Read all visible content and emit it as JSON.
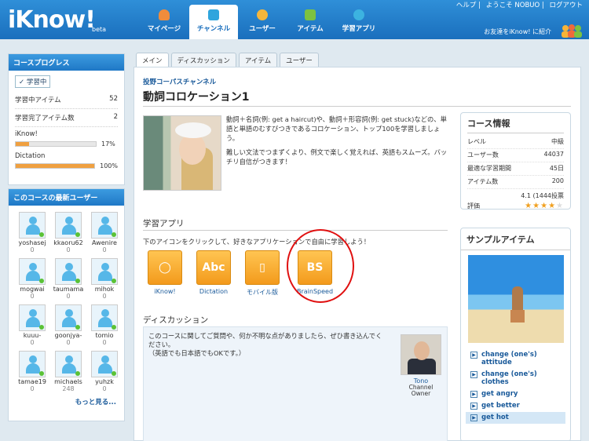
{
  "header": {
    "logo": "iKnow!",
    "beta": "beta",
    "top_links": [
      "ヘルプ",
      "ようこそ NOBUO",
      "ログアウト"
    ],
    "nav": [
      {
        "label": "マイページ",
        "icon": "person-icon",
        "color": "#f08c3c"
      },
      {
        "label": "チャンネル",
        "icon": "tv-icon",
        "color": "#2fa5dd"
      },
      {
        "label": "ユーザー",
        "icon": "users-icon",
        "color": "#f5b63c"
      },
      {
        "label": "アイテム",
        "icon": "list-icon",
        "color": "#7cc242"
      },
      {
        "label": "学習アプリ",
        "icon": "bubble-icon",
        "color": "#3cb3e0"
      }
    ],
    "active_nav": 1,
    "invite": "お友達をiKnow! に紹介"
  },
  "progress_panel": {
    "title": "コースプログレス",
    "status": "✓ 学習中",
    "rows": [
      {
        "label": "学習中アイテム",
        "value": "52"
      },
      {
        "label": "学習完了アイテム数",
        "value": "2"
      }
    ],
    "bars": [
      {
        "label": "iKnow!",
        "percent": 17,
        "display": "17%"
      },
      {
        "label": "Dictation",
        "percent": 100,
        "display": "100%"
      }
    ]
  },
  "users_panel": {
    "title": "このコースの最新ユーザー",
    "users": [
      {
        "name": "yoshasej",
        "count": "0"
      },
      {
        "name": "kkaoru62",
        "count": "0"
      },
      {
        "name": "Awenire",
        "count": "0"
      },
      {
        "name": "mogwai",
        "count": "0"
      },
      {
        "name": "taumama",
        "count": "0"
      },
      {
        "name": "mihok",
        "count": "0"
      },
      {
        "name": "kuuu-",
        "count": "0"
      },
      {
        "name": "goonjya-",
        "count": "0"
      },
      {
        "name": "tomio",
        "count": "0"
      },
      {
        "name": "tamae19",
        "count": "0"
      },
      {
        "name": "michaels",
        "count": "248"
      },
      {
        "name": "yuhzk",
        "count": "0"
      }
    ],
    "more": "もっと見る..."
  },
  "tabs": [
    "メイン",
    "ディスカッション",
    "アイテム",
    "ユーザー"
  ],
  "course": {
    "channel": "投野コーパスチャンネル",
    "title": "動詞コロケーション1",
    "desc1": "動詞＋名詞(例: get a haircut)や、動詞＋形容詞(例: get stuck)などの、単語と単語のむすびつきであるコロケーション、トップ100を学習しましょう。",
    "desc2": "難しい文法でつまずくより、例文で楽しく覚えれば、英語もスムーズ。バッチリ自信がつきます！"
  },
  "course_info": {
    "title": "コース情報",
    "rows": [
      {
        "label": "レベル",
        "value": "中級"
      },
      {
        "label": "ユーザー数",
        "value": "44037"
      },
      {
        "label": "最適な学習期間",
        "value": "45日"
      },
      {
        "label": "アイテム数",
        "value": "200"
      }
    ],
    "rating_label": "評価",
    "rating_text": "4.1 (1444投票",
    "rating_stars": 4
  },
  "apps": {
    "title": "学習アプリ",
    "note": "下のアイコンをクリックして、好きなアプリケーションで自由に学習しよう！",
    "items": [
      {
        "label": "iKnow!",
        "glyph": "◯",
        "icon": "speech-bubble-icon"
      },
      {
        "label": "Dictation",
        "glyph": "Abc",
        "icon": "dictation-icon"
      },
      {
        "label": "モバイル版",
        "glyph": "▯",
        "icon": "mobile-phone-icon"
      },
      {
        "label": "BrainSpeed",
        "glyph": "BS",
        "icon": "brainspeed-icon"
      }
    ]
  },
  "discussion": {
    "title": "ディスカッション",
    "text1": "このコースに関してご質問や、何か不明な点がありましたら、ぜひ書き込んでください。",
    "text2": "（英語でも日本語でもOKです。）",
    "owner_name": "Tono",
    "owner_role": "Channel Owner"
  },
  "samples": {
    "title": "サンプルアイテム",
    "items": [
      "change (one's) attitude",
      "change (one's) clothes",
      "get angry",
      "get better",
      "get hot"
    ],
    "selected": 4
  }
}
